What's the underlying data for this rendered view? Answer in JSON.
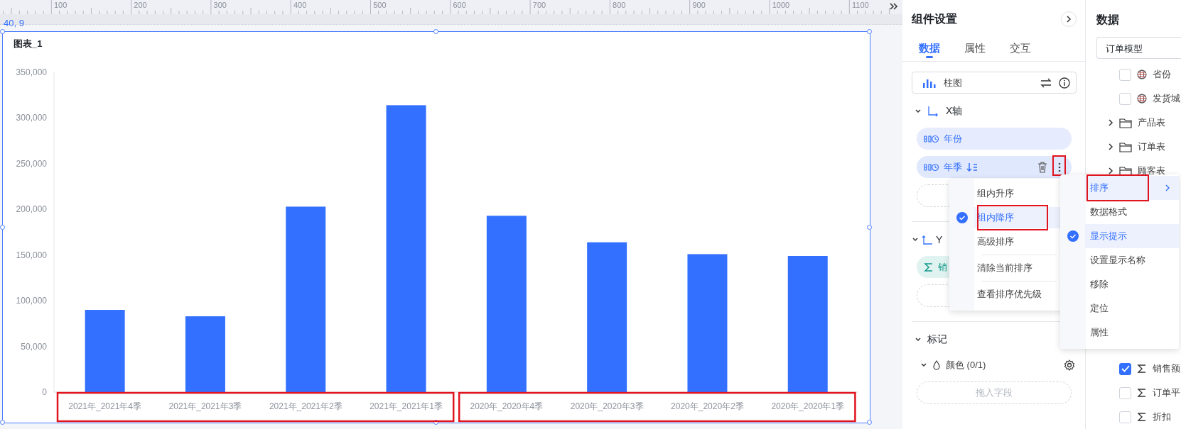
{
  "ruler": {
    "labels": [
      "100",
      "200",
      "300",
      "400",
      "500",
      "600",
      "700",
      "800",
      "900",
      "1000",
      "1100"
    ]
  },
  "canvas": {
    "coordinates": "40, 9"
  },
  "chart": {
    "title": "图表_1",
    "chart_data": {
      "type": "bar",
      "categories": [
        "2021年_2021年4季",
        "2021年_2021年3季",
        "2021年_2021年2季",
        "2021年_2021年1季",
        "2020年_2020年4季",
        "2020年_2020年3季",
        "2020年_2020年2季",
        "2020年_2020年1季"
      ],
      "values": [
        90000,
        83000,
        203000,
        314000,
        193000,
        164000,
        151000,
        149000
      ],
      "ylim": [
        0,
        350000
      ],
      "yticks": [
        {
          "value": 0,
          "label": "0"
        },
        {
          "value": 50000,
          "label": "50,000"
        },
        {
          "value": 100000,
          "label": "100,000"
        },
        {
          "value": 150000,
          "label": "150,000"
        },
        {
          "value": 200000,
          "label": "200,000"
        },
        {
          "value": 250000,
          "label": "250,000"
        },
        {
          "value": 300000,
          "label": "300,000"
        },
        {
          "value": 350000,
          "label": "350,000"
        }
      ]
    },
    "label_groups": [
      {
        "outlined": true
      },
      {
        "outlined": true
      }
    ]
  },
  "settings": {
    "title": "组件设置",
    "tabs": [
      {
        "label": "数据",
        "selected": true
      },
      {
        "label": "属性",
        "selected": false
      },
      {
        "label": "交互",
        "selected": false
      }
    ],
    "chart_type": "柱图",
    "x_axis": {
      "label": "X轴",
      "expanded": true,
      "fields": [
        {
          "label": "年份",
          "kind": "dimension",
          "sorted": false,
          "hovered": false,
          "outlined": false
        },
        {
          "label": "年季",
          "kind": "dimension",
          "sorted": true,
          "hovered": true,
          "outlined": true
        }
      ]
    },
    "y_axis": {
      "label": "Y",
      "expanded": true,
      "fields": [
        {
          "label": "销",
          "kind": "measure"
        }
      ]
    },
    "marks": {
      "label": "标记",
      "expanded": true,
      "color": {
        "label": "颜色 (0/1)",
        "expanded": true
      },
      "placeholder": "拖入字段"
    }
  },
  "data_panel": {
    "title": "数据",
    "model": "订单模型",
    "tree_top": [
      {
        "kind": "dimension",
        "label": "省份",
        "checked": false
      },
      {
        "kind": "dimension",
        "label": "发货城",
        "checked": false
      },
      {
        "kind": "folder",
        "label": "产品表",
        "expanded": false
      },
      {
        "kind": "folder",
        "label": "订单表",
        "expanded": false
      },
      {
        "kind": "folder",
        "label": "顾客表",
        "expanded": false
      }
    ],
    "tree_bottom": [
      {
        "kind": "measure",
        "label": "销售额",
        "checked": true
      },
      {
        "kind": "measure",
        "label": "订单平",
        "checked": false
      },
      {
        "kind": "measure",
        "label": "折扣",
        "checked": false
      }
    ]
  },
  "sort_menu": {
    "items": [
      {
        "kind": "item",
        "label": "组内升序",
        "checked": false,
        "selected": false,
        "outlined": false
      },
      {
        "kind": "item",
        "label": "组内降序",
        "checked": true,
        "selected": true,
        "outlined": true
      },
      {
        "kind": "item",
        "label": "高级排序",
        "checked": false,
        "selected": false,
        "outlined": false
      },
      {
        "kind": "divider"
      },
      {
        "kind": "item",
        "label": "清除当前排序",
        "checked": false,
        "selected": false,
        "outlined": false
      },
      {
        "kind": "divider"
      },
      {
        "kind": "item",
        "label": "查看排序优先级",
        "checked": false,
        "selected": false,
        "outlined": false
      }
    ]
  },
  "field_menu": {
    "items": [
      {
        "label": "排序",
        "checked": false,
        "selected": true,
        "outlined": true,
        "submenu": true
      },
      {
        "label": "数据格式",
        "checked": false,
        "selected": false,
        "outlined": false,
        "submenu": false
      },
      {
        "label": "显示提示",
        "checked": true,
        "selected": true,
        "outlined": false,
        "submenu": false
      },
      {
        "label": "设置显示名称",
        "checked": false,
        "selected": false,
        "outlined": false,
        "submenu": false
      },
      {
        "label": "移除",
        "checked": false,
        "selected": false,
        "outlined": false,
        "submenu": false
      },
      {
        "label": "定位",
        "checked": false,
        "selected": false,
        "outlined": false,
        "submenu": false
      },
      {
        "label": "属性",
        "checked": false,
        "selected": false,
        "outlined": false,
        "submenu": false
      }
    ]
  }
}
